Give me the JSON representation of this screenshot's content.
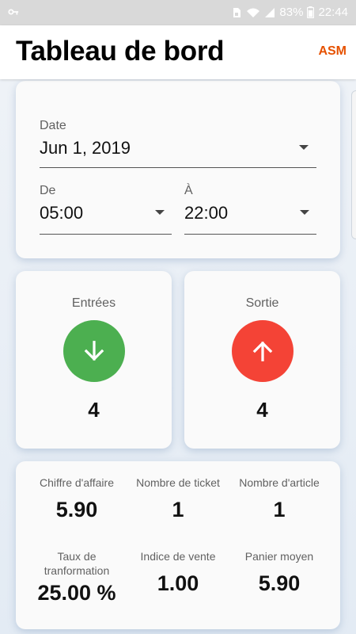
{
  "status_bar": {
    "battery": "83%",
    "time": "22:44",
    "icons": [
      "key-icon",
      "sim-icon",
      "wifi-icon",
      "signal-icon",
      "battery-icon"
    ]
  },
  "app_bar": {
    "title": "Tableau de bord",
    "action": "ASM",
    "action_color": "#e65100"
  },
  "filters": {
    "date_label": "Date",
    "date_value": "Jun 1, 2019",
    "from_label": "De",
    "from_value": "05:00",
    "to_label": "À",
    "to_value": "22:00"
  },
  "traffic": {
    "entries": {
      "label": "Entrées",
      "count": "4",
      "color": "#4caf50",
      "icon": "arrow-down-icon"
    },
    "exits": {
      "label": "Sortie",
      "count": "4",
      "color": "#f44336",
      "icon": "arrow-up-icon"
    }
  },
  "stats": [
    {
      "label": "Chiffre d'affaire",
      "value": "5.90"
    },
    {
      "label": "Nombre de ticket",
      "value": "1"
    },
    {
      "label": "Nombre d'article",
      "value": "1"
    },
    {
      "label": "Taux de tranformation",
      "value": "25.00 %"
    },
    {
      "label": "Indice de vente",
      "value": "1.00"
    },
    {
      "label": "Panier moyen",
      "value": "5.90"
    }
  ]
}
